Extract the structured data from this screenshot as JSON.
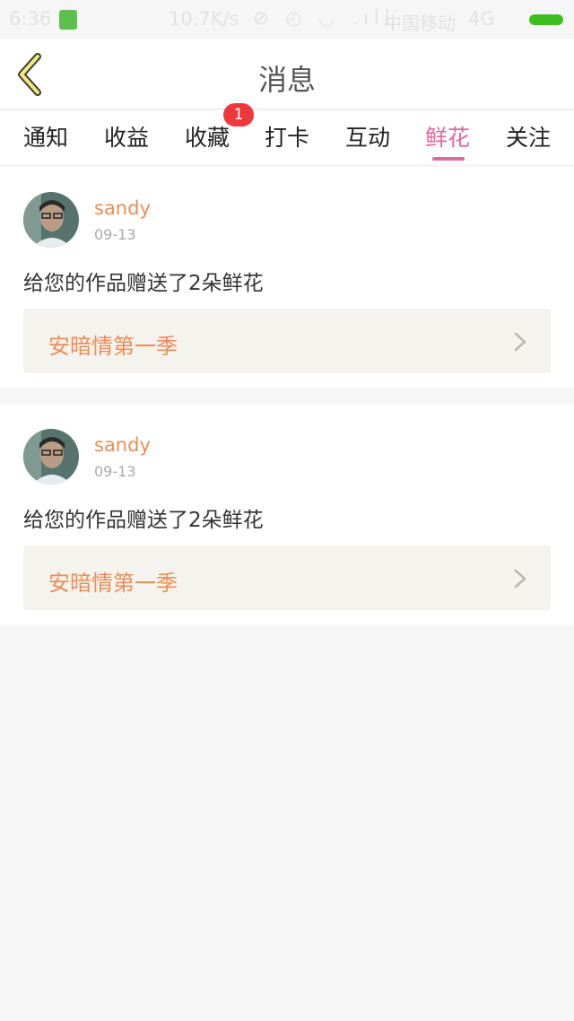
{
  "status_bar": {
    "time": "6:36",
    "speed": "10.7K/s",
    "carrier": "中国移动",
    "network": "4G"
  },
  "header": {
    "title": "消息",
    "back_icon": "chevron-left-icon"
  },
  "tabs": [
    {
      "label": "通知"
    },
    {
      "label": "收益"
    },
    {
      "label": "收藏",
      "badge": "1"
    },
    {
      "label": "打卡"
    },
    {
      "label": "互动"
    },
    {
      "label": "鲜花",
      "active": true
    },
    {
      "label": "关注"
    }
  ],
  "colors": {
    "accent": "#e4679f",
    "username": "#ee8c56",
    "badge": "#f0383c",
    "link_bg": "#f4f3ed"
  },
  "messages": [
    {
      "username": "sandy",
      "date": "09-13",
      "text": "给您的作品赠送了2朵鲜花",
      "work_title": "安暗情第一季"
    },
    {
      "username": "sandy",
      "date": "09-13",
      "text": "给您的作品赠送了2朵鲜花",
      "work_title": "安暗情第一季"
    }
  ]
}
